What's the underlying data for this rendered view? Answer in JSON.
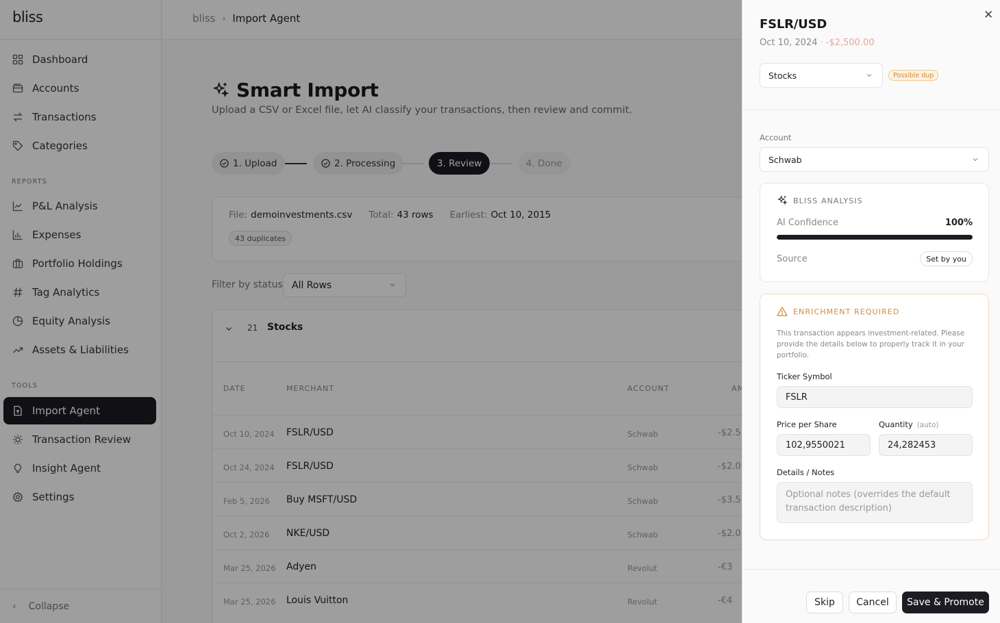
{
  "app": {
    "logo": "bliss"
  },
  "sidebar": {
    "items": [
      {
        "label": "Dashboard",
        "icon": "grid-icon"
      },
      {
        "label": "Accounts",
        "icon": "wallet-icon"
      },
      {
        "label": "Transactions",
        "icon": "arrows-swap-icon"
      },
      {
        "label": "Categories",
        "icon": "tag-icon"
      }
    ],
    "reports_label": "REPORTS",
    "reports": [
      {
        "label": "P&L Analysis",
        "icon": "line-chart-icon"
      },
      {
        "label": "Expenses",
        "icon": "bar-chart-icon"
      },
      {
        "label": "Portfolio Holdings",
        "icon": "briefcase-icon"
      },
      {
        "label": "Tag Analytics",
        "icon": "hash-icon"
      },
      {
        "label": "Equity Analysis",
        "icon": "pie-chart-icon"
      },
      {
        "label": "Assets & Liabilities",
        "icon": "trend-up-icon"
      }
    ],
    "tools_label": "TOOLS",
    "tools": [
      {
        "label": "Import Agent",
        "icon": "file-upload-icon",
        "active": true
      },
      {
        "label": "Transaction Review",
        "icon": "sun-icon"
      },
      {
        "label": "Insight Agent",
        "icon": "lightbulb-icon"
      },
      {
        "label": "Settings",
        "icon": "gear-icon"
      }
    ],
    "collapse_label": "Collapse"
  },
  "breadcrumb": {
    "root": "bliss",
    "current": "Import Agent"
  },
  "page": {
    "title": "Smart Import",
    "subtitle": "Upload a CSV or Excel file, let AI classify your transactions, then review and commit."
  },
  "steps": [
    {
      "label": "1. Upload",
      "state": "done"
    },
    {
      "label": "2. Processing",
      "state": "done"
    },
    {
      "label": "3. Review",
      "state": "active"
    },
    {
      "label": "4. Done",
      "state": "future"
    }
  ],
  "file": {
    "file_label": "File:",
    "file_value": "demoinvestments.csv",
    "total_label": "Total:",
    "total_value": "43 rows",
    "earliest_label": "Earliest:",
    "earliest_value": "Oct 10, 2015",
    "dup_badge": "43 duplicates"
  },
  "filter": {
    "label": "Filter by status:",
    "value": "All Rows"
  },
  "group": {
    "count": "21",
    "name": "Stocks"
  },
  "table": {
    "columns": {
      "date": "DATE",
      "merchant": "MERCHANT",
      "account": "ACCOUNT",
      "amount": "AM"
    },
    "rows": [
      {
        "date": "Oct 10, 2024",
        "merchant": "FSLR/USD",
        "account": "Schwab",
        "amount": "-$2.5"
      },
      {
        "date": "Oct 24, 2024",
        "merchant": "FSLR/USD",
        "account": "Schwab",
        "amount": "-$2.0"
      },
      {
        "date": "Feb 5, 2026",
        "merchant": "Buy MSFT/USD",
        "account": "Schwab",
        "amount": "-$3.5"
      },
      {
        "date": "Oct 2, 2026",
        "merchant": "NKE/USD",
        "account": "Schwab",
        "amount": "-$2.0"
      },
      {
        "date": "Mar 25, 2026",
        "merchant": "Adyen",
        "account": "Revolut",
        "amount": "-€3"
      },
      {
        "date": "Mar 25, 2026",
        "merchant": "Louis Vuitton",
        "account": "Revolut",
        "amount": "-€4"
      }
    ]
  },
  "drawer": {
    "title": "FSLR/USD",
    "date": "Oct 10, 2024",
    "dot": "·",
    "amount": "-$2,500.00",
    "category": "Stocks",
    "dup_pill": "Possible dup",
    "account_label": "Account",
    "account_value": "Schwab",
    "analysis": {
      "heading": "BLISS ANALYSIS",
      "confidence_label": "AI Confidence",
      "confidence_value": "100%",
      "confidence_fraction": 1.0,
      "source_label": "Source",
      "source_value": "Set by you"
    },
    "enrichment": {
      "heading": "ENRICHMENT REQUIRED",
      "description": "This transaction appears investment-related. Please provide the details below to properly track it in your portfolio.",
      "ticker_label": "Ticker Symbol",
      "ticker_value": "FSLR",
      "price_label": "Price per Share",
      "price_value": "102,9550021",
      "qty_label": "Quantity",
      "qty_hint": "(auto)",
      "qty_value": "24,282453",
      "notes_label": "Details / Notes",
      "notes_placeholder": "Optional notes (overrides the default transaction description)"
    },
    "buttons": {
      "skip": "Skip",
      "cancel": "Cancel",
      "save": "Save & Promote"
    }
  },
  "colors": {
    "accent": "#1c1c22",
    "warning": "#d48b3a",
    "negative": "#e0a89a"
  }
}
